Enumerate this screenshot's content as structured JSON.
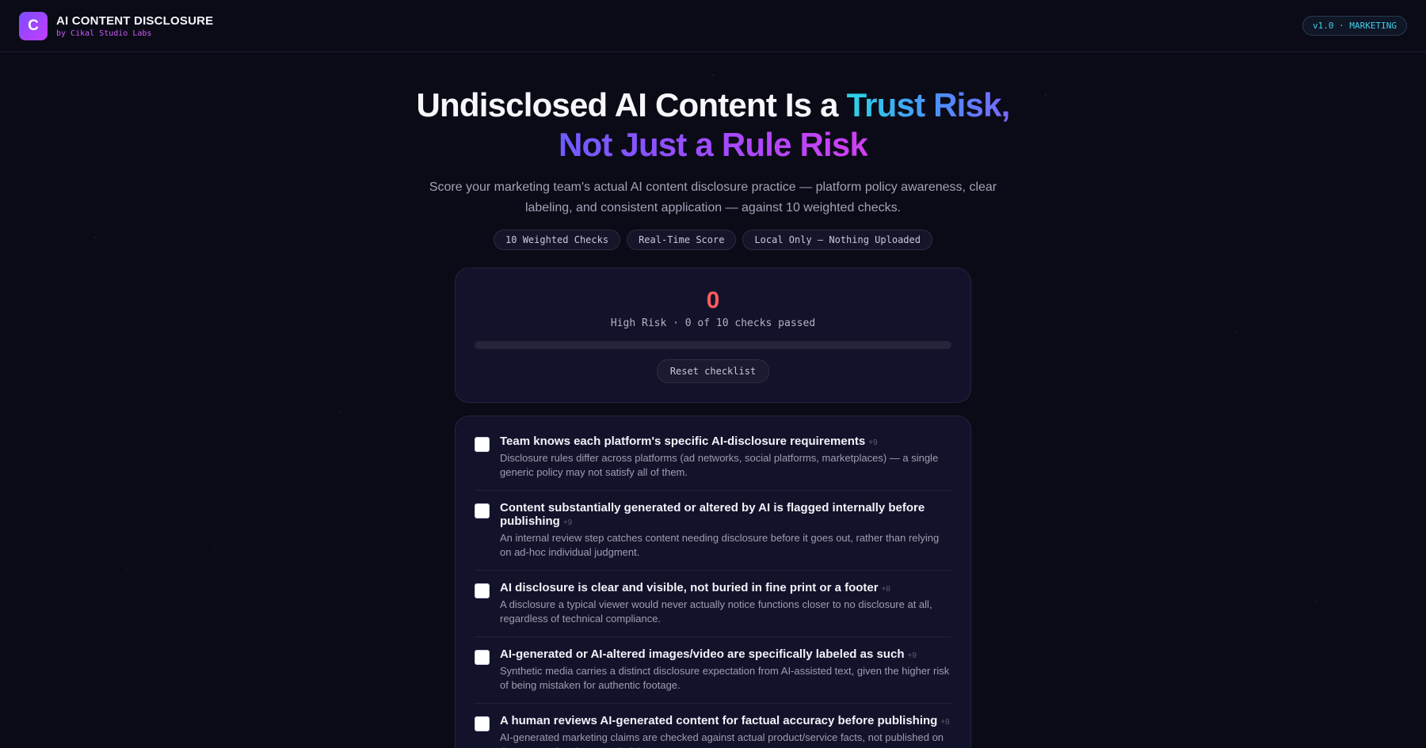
{
  "header": {
    "logo_letter": "C",
    "title": "AI CONTENT DISCLOSURE",
    "byline": "by Cikal Studio Labs",
    "version_badge": "v1.0 · MARKETING"
  },
  "hero": {
    "title_plain": "Undisclosed AI Content Is a ",
    "title_highlight1": "Trust Risk,",
    "title_highlight2": "Not Just a Rule Risk",
    "subtitle": "Score your marketing team's actual AI content disclosure practice — platform policy awareness, clear labeling, and consistent application — against 10 weighted checks.",
    "chips": [
      "10 Weighted Checks",
      "Real-Time Score",
      "Local Only — Nothing Uploaded"
    ]
  },
  "score": {
    "value": "0",
    "label": "High Risk · 0 of 10 checks passed",
    "progress_fraction": 0,
    "reset_label": "Reset checklist",
    "color": "#ff5c5c"
  },
  "checks": [
    {
      "title": "Team knows each platform's specific AI-disclosure requirements",
      "weight": "+9",
      "desc": "Disclosure rules differ across platforms (ad networks, social platforms, marketplaces) — a single generic policy may not satisfy all of them.",
      "checked": false
    },
    {
      "title": "Content substantially generated or altered by AI is flagged internally before publishing",
      "weight": "+9",
      "desc": "An internal review step catches content needing disclosure before it goes out, rather than relying on ad-hoc individual judgment.",
      "checked": false
    },
    {
      "title": "AI disclosure is clear and visible, not buried in fine print or a footer",
      "weight": "+8",
      "desc": "A disclosure a typical viewer would never actually notice functions closer to no disclosure at all, regardless of technical compliance.",
      "checked": false
    },
    {
      "title": "AI-generated or AI-altered images/video are specifically labeled as such",
      "weight": "+9",
      "desc": "Synthetic media carries a distinct disclosure expectation from AI-assisted text, given the higher risk of being mistaken for authentic footage.",
      "checked": false
    },
    {
      "title": "A human reviews AI-generated content for factual accuracy before publishing",
      "weight": "+8",
      "desc": "AI-generated marketing claims are checked against actual product/service facts, not published on the assumption the AI got it right.",
      "checked": false
    }
  ]
}
